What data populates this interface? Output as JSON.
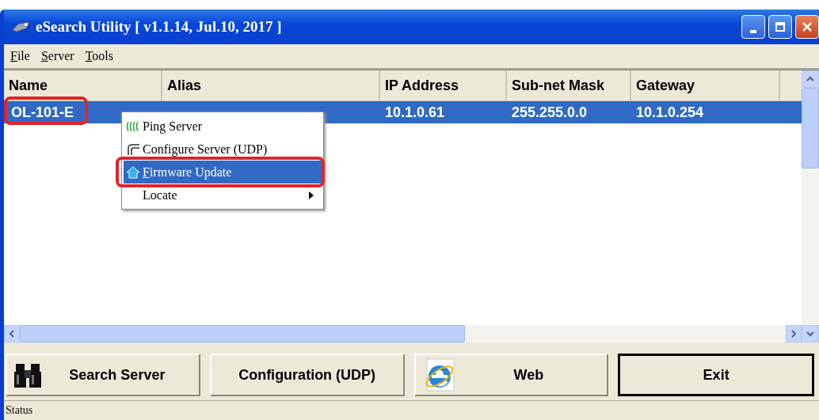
{
  "window": {
    "title": "eSearch Utility [ v1.1.14, Jul.10, 2017 ]"
  },
  "menu": [
    {
      "label": "File"
    },
    {
      "label": "Server"
    },
    {
      "label": "Tools"
    }
  ],
  "table": {
    "columns": [
      "Name",
      "Alias",
      "IP Address",
      "Sub-net Mask",
      "Gateway"
    ],
    "rows": [
      {
        "cells": [
          {
            "text": "OL-101-E"
          },
          {},
          {
            "text": "10.1.0.61"
          },
          {
            "text": "255.255.0.0"
          },
          {
            "text": "10.1.0.254"
          }
        ],
        "selected": true,
        "highlighted": true
      }
    ]
  },
  "context_menu": {
    "items": [
      {
        "label": "Ping Server",
        "kind": "ping",
        "selected": false,
        "highlighted": false,
        "submenu": false
      },
      {
        "label": "Configure Server (UDP)",
        "kind": "configure",
        "selected": false,
        "highlighted": false,
        "submenu": false
      },
      {
        "label": "Firmware Update",
        "kind": "firmware",
        "selected": true,
        "highlighted": true,
        "submenu": false
      },
      {
        "label": "Locate",
        "kind": "plain",
        "selected": false,
        "highlighted": false,
        "submenu": true
      }
    ]
  },
  "buttons": [
    {
      "label": "Search Server",
      "kind": "search",
      "default": false
    },
    {
      "label": "Configuration (UDP)",
      "kind": "plain",
      "default": false
    },
    {
      "label": "Web",
      "kind": "web",
      "default": false
    },
    {
      "label": "Exit",
      "kind": "plain",
      "default": true
    }
  ],
  "status_bar": "Status"
}
